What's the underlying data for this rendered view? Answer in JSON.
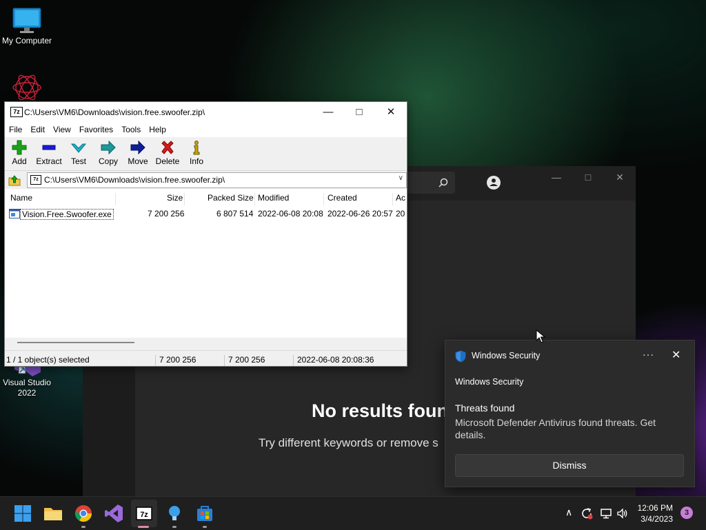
{
  "desktop": {
    "icons": [
      {
        "label": "My Computer",
        "icon": "computer-icon"
      },
      {
        "label": "",
        "icon": "flower-logo-icon"
      },
      {
        "label": "Visual Studio 2022",
        "icon": "visual-studio-icon"
      }
    ]
  },
  "background_app": {
    "no_results": "No results foun",
    "try_text": "Try different keywords or remove s"
  },
  "zip_window": {
    "title": "C:\\Users\\VM6\\Downloads\\vision.free.swoofer.zip\\",
    "title_icon": "7z",
    "menu": [
      "File",
      "Edit",
      "View",
      "Favorites",
      "Tools",
      "Help"
    ],
    "toolbar": [
      {
        "label": "Add",
        "icon": "plus-icon",
        "color": "#1aa31a"
      },
      {
        "label": "Extract",
        "icon": "minus-icon",
        "color": "#1a1ad8"
      },
      {
        "label": "Test",
        "icon": "check-icon",
        "color": "#19b3c9"
      },
      {
        "label": "Copy",
        "icon": "copy-arrow-icon",
        "color": "#1a9a9a"
      },
      {
        "label": "Move",
        "icon": "move-arrow-icon",
        "color": "#0a1f9a"
      },
      {
        "label": "Delete",
        "icon": "delete-x-icon",
        "color": "#d61a1a"
      },
      {
        "label": "Info",
        "icon": "info-icon",
        "color": "#c8a400"
      }
    ],
    "address": "C:\\Users\\VM6\\Downloads\\vision.free.swoofer.zip\\",
    "columns": [
      "Name",
      "Size",
      "Packed Size",
      "Modified",
      "Created",
      "Ac"
    ],
    "rows": [
      {
        "name": "Vision.Free.Swoofer.exe",
        "size": "7 200 256",
        "packed": "6 807 514",
        "modified": "2022-06-08 20:08",
        "created": "2022-06-26 20:57",
        "accessed": "20"
      }
    ],
    "status": {
      "selected": "1 / 1 object(s) selected",
      "size": "7 200 256",
      "size2": "7 200 256",
      "date": "2022-06-08 20:08:36"
    }
  },
  "toast": {
    "app_name": "Windows Security",
    "header": "Windows Security",
    "title": "Threats found",
    "body": "Microsoft Defender Antivirus found threats. Get details.",
    "dismiss": "Dismiss",
    "more": "···",
    "close": "✕"
  },
  "taskbar": {
    "time": "12:06 PM",
    "date": "3/4/2023",
    "notifications": "3"
  },
  "colors": {
    "accent_blue": "#0067c0",
    "taskbar_bg": "#1f1f1f",
    "toast_bg": "#2b2b2b"
  }
}
